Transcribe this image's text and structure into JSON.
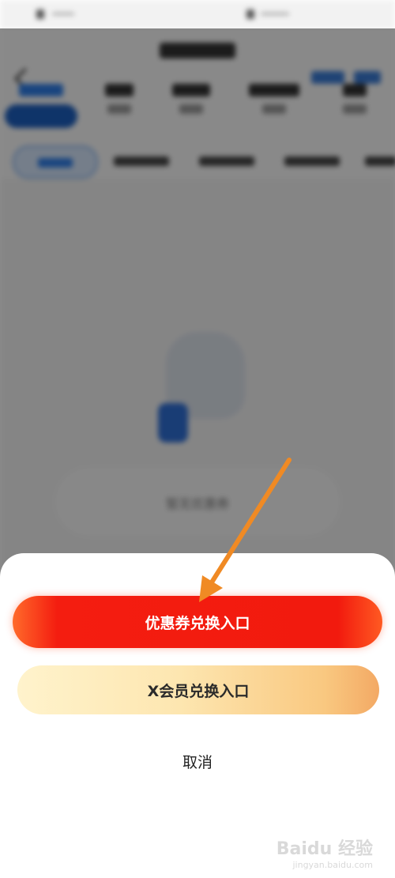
{
  "sheet": {
    "coupon_button_label": "优惠券兑换入口",
    "vip_button_label": "X会员兑换入口",
    "cancel_label": "取消"
  },
  "background_page": {
    "empty_state_text": "暂无优惠券"
  },
  "watermark": {
    "brand": "Baidu 经验",
    "url": "jingyan.baidu.com"
  },
  "colors": {
    "coupon_button": "#f21a0e",
    "vip_button_start": "#fff3cc",
    "vip_button_end": "#f3a964",
    "annotation_arrow": "#f08a24",
    "accent_blue": "#2f7ee8"
  },
  "icons": {
    "back": "chevron-left-icon",
    "arrow": "annotation-arrow-icon"
  }
}
